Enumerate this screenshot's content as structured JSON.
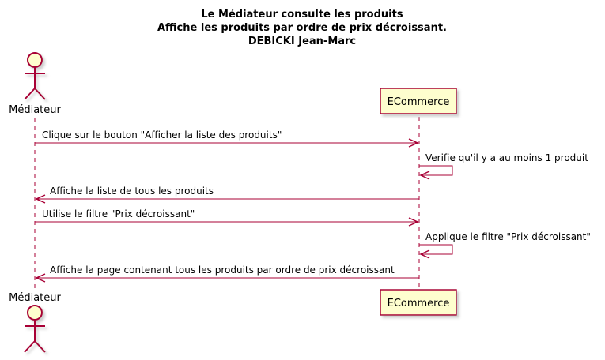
{
  "title": {
    "line1": "Le Médiateur consulte les produits",
    "line2": "Affiche les produits par ordre de prix décroissant.",
    "line3": "DEBICKI Jean-Marc"
  },
  "participants": {
    "actor": "Médiateur",
    "system": "ECommerce"
  },
  "messages": [
    "Clique sur le bouton \"Afficher la liste des produits\"",
    "Verifie qu'il y a au moins 1 produit",
    "Affiche la liste de tous les produits",
    "Utilise le filtre \"Prix décroissant\"",
    "Applique le filtre \"Prix décroissant\"",
    "Affiche la page contenant tous les produits par ordre de prix décroissant"
  ],
  "colors": {
    "line": "#A80036",
    "box_fill": "#FEFECE",
    "shadow": "#C8C8C8"
  }
}
